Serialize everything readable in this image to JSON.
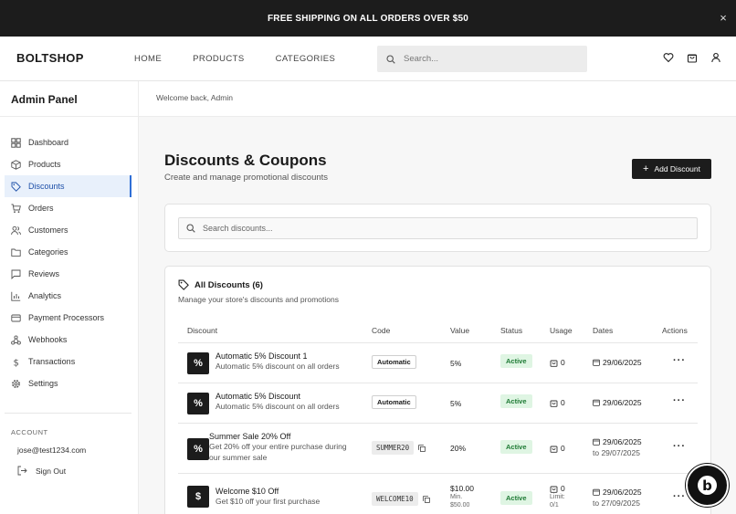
{
  "announcement": {
    "text": "FREE SHIPPING ON ALL ORDERS OVER $50",
    "close": "×"
  },
  "header": {
    "logo": "BOLTSHOP",
    "nav": [
      "HOME",
      "PRODUCTS",
      "CATEGORIES"
    ],
    "search_placeholder": "Search..."
  },
  "sidebar": {
    "title": "Admin Panel",
    "items": [
      {
        "label": "Dashboard",
        "icon": "grid-icon"
      },
      {
        "label": "Products",
        "icon": "box-icon"
      },
      {
        "label": "Discounts",
        "icon": "tag-icon",
        "active": true
      },
      {
        "label": "Orders",
        "icon": "cart-icon"
      },
      {
        "label": "Customers",
        "icon": "users-icon"
      },
      {
        "label": "Categories",
        "icon": "folder-icon"
      },
      {
        "label": "Reviews",
        "icon": "message-icon"
      },
      {
        "label": "Analytics",
        "icon": "chart-icon"
      },
      {
        "label": "Payment Processors",
        "icon": "card-icon"
      },
      {
        "label": "Webhooks",
        "icon": "webhook-icon"
      },
      {
        "label": "Transactions",
        "icon": "dollar-icon"
      },
      {
        "label": "Settings",
        "icon": "gear-icon"
      }
    ],
    "account_label": "ACCOUNT",
    "email": "jose@test1234.com",
    "sign_out": "Sign Out"
  },
  "main": {
    "welcome": "Welcome back, Admin",
    "title": "Discounts & Coupons",
    "subtitle": "Create and manage promotional discounts",
    "add_button": "Add Discount",
    "search_placeholder": "Search discounts...",
    "table_title": "All Discounts (6)",
    "table_subtitle": "Manage your store's discounts and promotions",
    "columns": [
      "Discount",
      "Code",
      "Value",
      "Status",
      "Usage",
      "Dates",
      "Actions"
    ],
    "rows": [
      {
        "name": "Automatic 5% Discount 1",
        "desc": "Automatic 5% discount on all orders",
        "code": "Automatic",
        "value": "5%",
        "status": "Active",
        "usage": "0",
        "date_from": "29/06/2025",
        "icon": "%"
      },
      {
        "name": "Automatic 5% Discount",
        "desc": "Automatic 5% discount on all orders",
        "code": "Automatic",
        "value": "5%",
        "status": "Active",
        "usage": "0",
        "date_from": "29/06/2025",
        "icon": "%"
      },
      {
        "name": "Summer Sale 20% Off",
        "desc": "Get 20% off your entire purchase during our summer sale",
        "code": "SUMMER20",
        "value": "20%",
        "status": "Active",
        "usage": "0",
        "date_from": "29/06/2025",
        "date_to": "to 29/07/2025",
        "icon": "%"
      },
      {
        "name": "Welcome $10 Off",
        "desc": "Get $10 off your first purchase",
        "code": "WELCOME10",
        "value": "$10.00",
        "value_min": "Min.",
        "value_min_amount": "$50.00",
        "status": "Active",
        "usage": "0",
        "usage_limit": "Limit:",
        "usage_limit_amount": "0/1",
        "date_from": "29/06/2025",
        "date_to": "to 27/09/2025",
        "icon": "$"
      }
    ],
    "actions": "···"
  },
  "colors": {
    "accent": "#2f6fd6",
    "dark": "#1c1c1c",
    "status_bg": "#dff5e3",
    "status_text": "#1d7a34"
  },
  "badge": "b"
}
